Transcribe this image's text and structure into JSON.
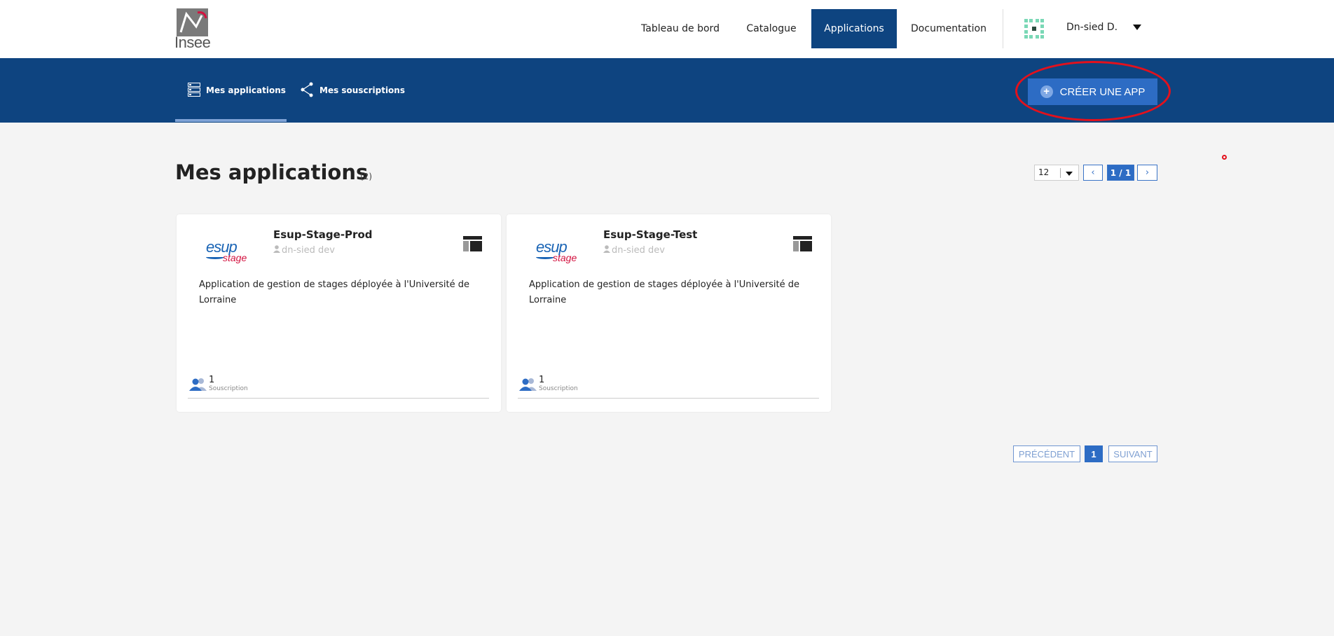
{
  "header": {
    "logo_text": "Insee",
    "nav": [
      {
        "label": "Tableau de bord"
      },
      {
        "label": "Catalogue"
      },
      {
        "label": "Applications",
        "active": true
      },
      {
        "label": "Documentation"
      }
    ],
    "user_name": "Dn-sied D."
  },
  "subnav": {
    "tabs": [
      {
        "label": "Mes applications",
        "icon": "server-icon",
        "active": true
      },
      {
        "label": "Mes souscriptions",
        "icon": "share-icon"
      }
    ],
    "create_button": "CRÉER UNE APP"
  },
  "main": {
    "title": "Mes applications",
    "count": "(2)",
    "per_page": "12",
    "page_indicator": "1 / 1",
    "prev_arrow": "‹",
    "next_arrow": "›"
  },
  "apps": [
    {
      "logo_main": "esup",
      "logo_sub": "stage",
      "name": "Esup-Stage-Prod",
      "owner": "dn-sied dev",
      "description": "Application de gestion de stages déployée à l'Université de Lorraine",
      "subscriptions_count": "1",
      "subscriptions_label": "Souscription"
    },
    {
      "logo_main": "esup",
      "logo_sub": "stage",
      "name": "Esup-Stage-Test",
      "owner": "dn-sied dev",
      "description": "Application de gestion de stages déployée à l'Université de Lorraine",
      "subscriptions_count": "1",
      "subscriptions_label": "Souscription"
    }
  ],
  "pagination": {
    "previous": "PRÉCÉDENT",
    "current": "1",
    "next": "SUIVANT"
  },
  "colors": {
    "primary": "#0e4480",
    "accent": "#2d6cc4",
    "highlight_ellipse": "#e3111c"
  }
}
